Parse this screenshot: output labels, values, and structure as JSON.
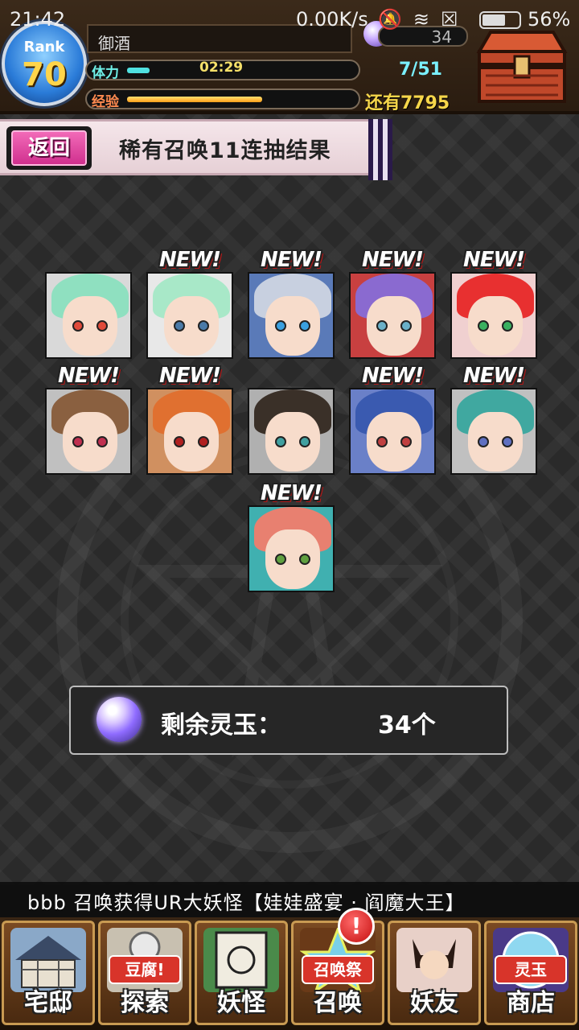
{
  "statusbar": {
    "time": "21:42",
    "network": "0.00K/s",
    "battery": "56%"
  },
  "player": {
    "rank_label": "Rank",
    "rank_value": "70",
    "name": "御酒",
    "stamina_label": "体力",
    "stamina_timer": "02:29",
    "stamina_value": "7/51",
    "stamina_fill": 0.1,
    "exp_label": "经验",
    "exp_remaining": "还有7795",
    "exp_fill": 0.6,
    "orbs": "34"
  },
  "banner": {
    "back_label": "返回",
    "title": "稀有召唤11连抽结果"
  },
  "results": {
    "new_label": "NEW!",
    "cards": [
      {
        "name": "card-1",
        "new": false,
        "hair": "#8fe0c0",
        "eye": "#e04a3a",
        "bg": "#d9d9d9"
      },
      {
        "name": "card-2",
        "new": true,
        "hair": "#a8e8c8",
        "eye": "#4a7aa8",
        "bg": "#e8e8e8"
      },
      {
        "name": "card-3",
        "new": true,
        "hair": "#c8d0e0",
        "eye": "#3aa0e0",
        "bg": "#5a7ab8"
      },
      {
        "name": "card-4",
        "new": true,
        "hair": "#8a6ad0",
        "eye": "#6ab0c8",
        "bg": "#c84040"
      },
      {
        "name": "card-5",
        "new": true,
        "hair": "#e83030",
        "eye": "#3ab060",
        "bg": "#f0d0d0"
      },
      {
        "name": "card-6",
        "new": true,
        "hair": "#8a6040",
        "eye": "#c03050",
        "bg": "#c0c0c0"
      },
      {
        "name": "card-7",
        "new": true,
        "hair": "#e07030",
        "eye": "#b02020",
        "bg": "#d09060"
      },
      {
        "name": "card-8",
        "new": false,
        "hair": "#3a3028",
        "eye": "#40a0a0",
        "bg": "#b0b0b0"
      },
      {
        "name": "card-9",
        "new": true,
        "hair": "#3a5ab0",
        "eye": "#c04040",
        "bg": "#6a80c8"
      },
      {
        "name": "card-10",
        "new": true,
        "hair": "#40a8a0",
        "eye": "#6070c0",
        "bg": "#c0c0c0"
      },
      {
        "name": "card-11",
        "new": true,
        "hair": "#e88070",
        "eye": "#60a040",
        "bg": "#40b0b0"
      }
    ]
  },
  "remaining": {
    "label": "剩余灵玉：",
    "value": "34个"
  },
  "ticker": {
    "text": "bbb 召唤获得UR大妖怪【娃娃盛宴 · 阎魔大王】"
  },
  "nav": {
    "items": [
      {
        "label": "宅邸",
        "sub": ""
      },
      {
        "label": "探索",
        "sub": "豆腐!"
      },
      {
        "label": "妖怪",
        "sub": ""
      },
      {
        "label": "召唤",
        "sub": "召唤祭"
      },
      {
        "label": "妖友",
        "sub": ""
      },
      {
        "label": "商店",
        "sub": "灵玉"
      }
    ],
    "alert": "!"
  },
  "colors": {
    "accent_pink": "#d0308e",
    "stamina": "#4fe0e0",
    "exp": "#ff9f1a",
    "gold_text": "#f6d64a"
  }
}
